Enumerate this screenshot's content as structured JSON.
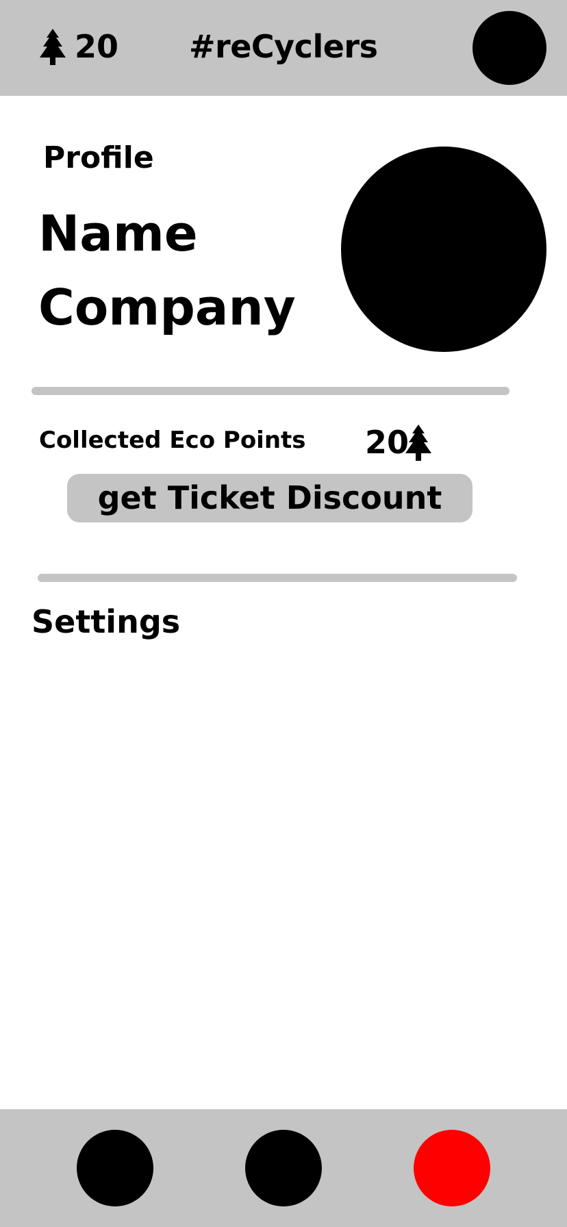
{
  "header": {
    "points": "20",
    "app_title": "#reCyclers",
    "tree_icon": "tree-icon",
    "avatar_icon": "user-avatar-icon"
  },
  "profile": {
    "section_title": "Profile",
    "name": "Name",
    "company": "Company",
    "photo_icon": "profile-photo-icon"
  },
  "eco": {
    "label": "Collected Eco Points",
    "points": "20",
    "tree_icon": "tree-icon",
    "button_label": "get Ticket Discount"
  },
  "settings": {
    "section_title": "Settings"
  },
  "bottom_nav": {
    "background": "#c4c4c4",
    "items": [
      {
        "icon": "nav-circle-icon",
        "color": "#000000",
        "active": false
      },
      {
        "icon": "nav-circle-icon",
        "color": "#000000",
        "active": false
      },
      {
        "icon": "nav-circle-icon",
        "color": "#ff0000",
        "active": true
      }
    ]
  },
  "colors": {
    "bar_gray": "#c4c4c4",
    "active": "#ff0000",
    "text": "#000000"
  }
}
